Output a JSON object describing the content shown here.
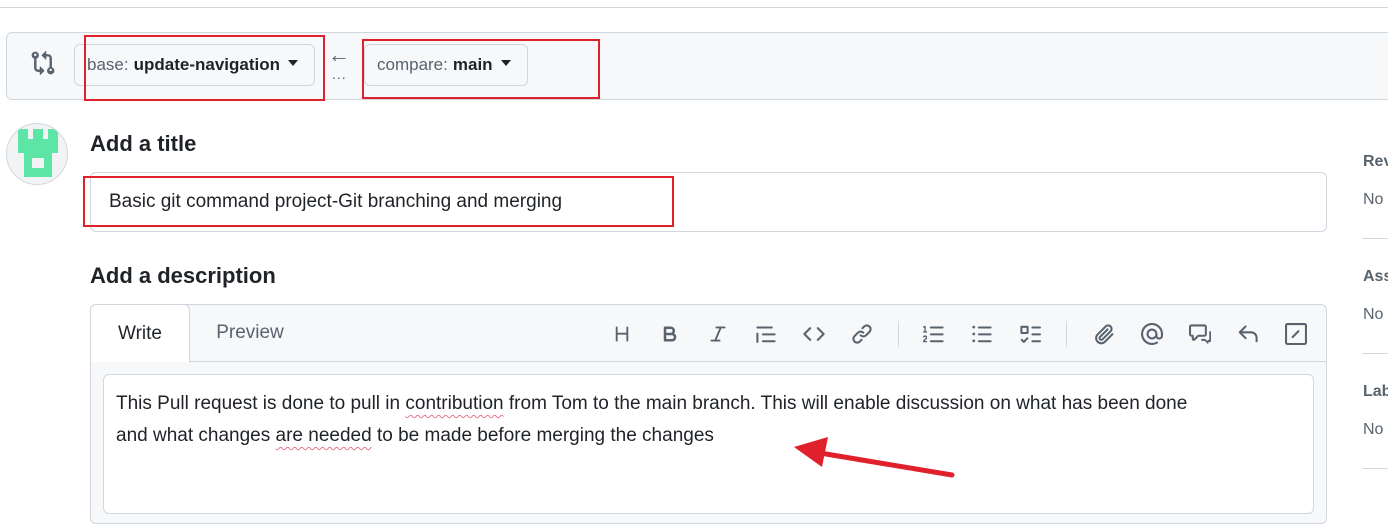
{
  "compare_bar": {
    "base_prefix": "base:",
    "base_branch": "update-navigation",
    "compare_prefix": "compare:",
    "compare_branch": "main",
    "swap_arrow": "←",
    "swap_dots": "...",
    "icons": [
      "git-compare-icon",
      "arrow-left-icon",
      "caret-down-icon"
    ]
  },
  "form": {
    "title_heading": "Add a title",
    "title_value": "Basic git command project-Git branching and merging",
    "description_heading": "Add a description",
    "tabs": {
      "write": "Write",
      "preview": "Preview"
    },
    "description_segments": {
      "l1_a": "This Pull request is done to pull in ",
      "l1_b": "contribution",
      "l1_c": " from Tom to the main branch. This will enable discussion on what has been done",
      "l2_a": "and what changes ",
      "l2_b": "are needed",
      "l2_c": " to be made before merging the changes"
    },
    "toolbar_icons": [
      "heading-icon",
      "bold-icon",
      "italic-icon",
      "quote-icon",
      "code-icon",
      "link-icon",
      "ordered-list-icon",
      "unordered-list-icon",
      "task-list-icon",
      "attach-icon",
      "mention-icon",
      "cross-reference-icon",
      "reply-icon",
      "slash-command-icon"
    ]
  },
  "sidebar": {
    "items": [
      {
        "label": "Rev",
        "value": "No"
      },
      {
        "label": "Ass",
        "value": "No"
      },
      {
        "label": "Lab",
        "value": "No"
      }
    ]
  },
  "annotations": {
    "highlight_color": "#e0202a"
  },
  "colors": {
    "border": "#d0d7de",
    "muted": "#59636e",
    "avatar": "#5de5a6"
  }
}
